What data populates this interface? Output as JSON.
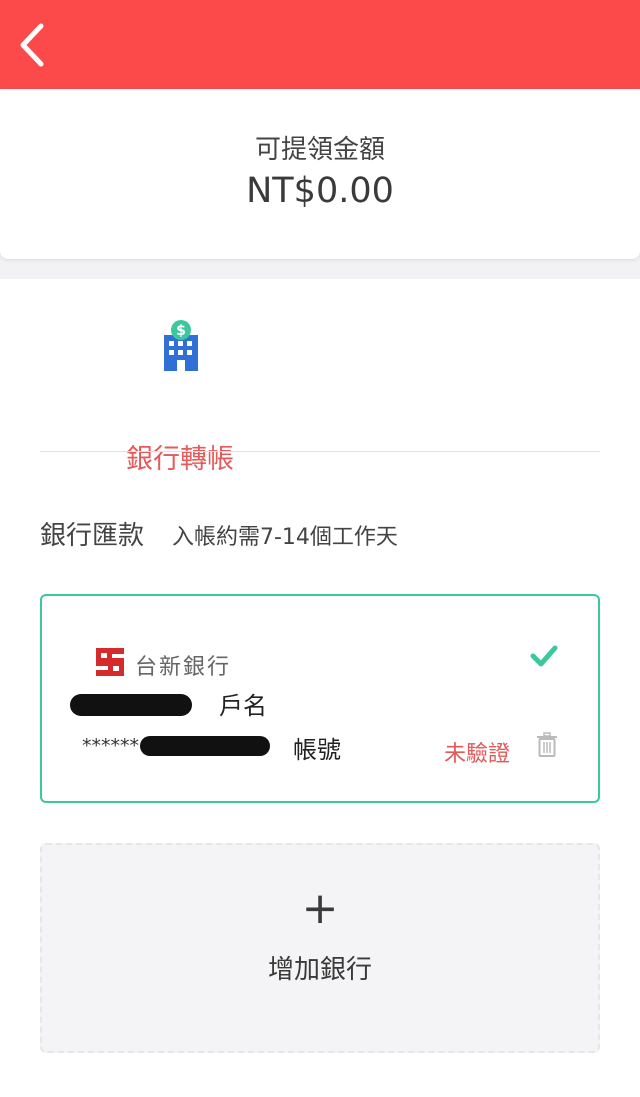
{
  "header": {
    "back_icon": "chevron-left-icon",
    "bg_color": "#fc4a4a"
  },
  "balance": {
    "label": "可提領金額",
    "amount": "NT$0.00"
  },
  "tabs": [
    {
      "label": "銀行轉帳",
      "icon": "bank-building-icon",
      "active": true
    }
  ],
  "section": {
    "title": "銀行匯款",
    "note": "入帳約需7-14個工作天"
  },
  "bank_account": {
    "bank_name": "台新銀行",
    "holder_label": "戶名",
    "account_mask": "******",
    "account_label": "帳號",
    "status": "未驗證",
    "selected": true,
    "accent_color": "#3cc79d"
  },
  "add_bank": {
    "plus": "+",
    "label": "增加銀行"
  }
}
